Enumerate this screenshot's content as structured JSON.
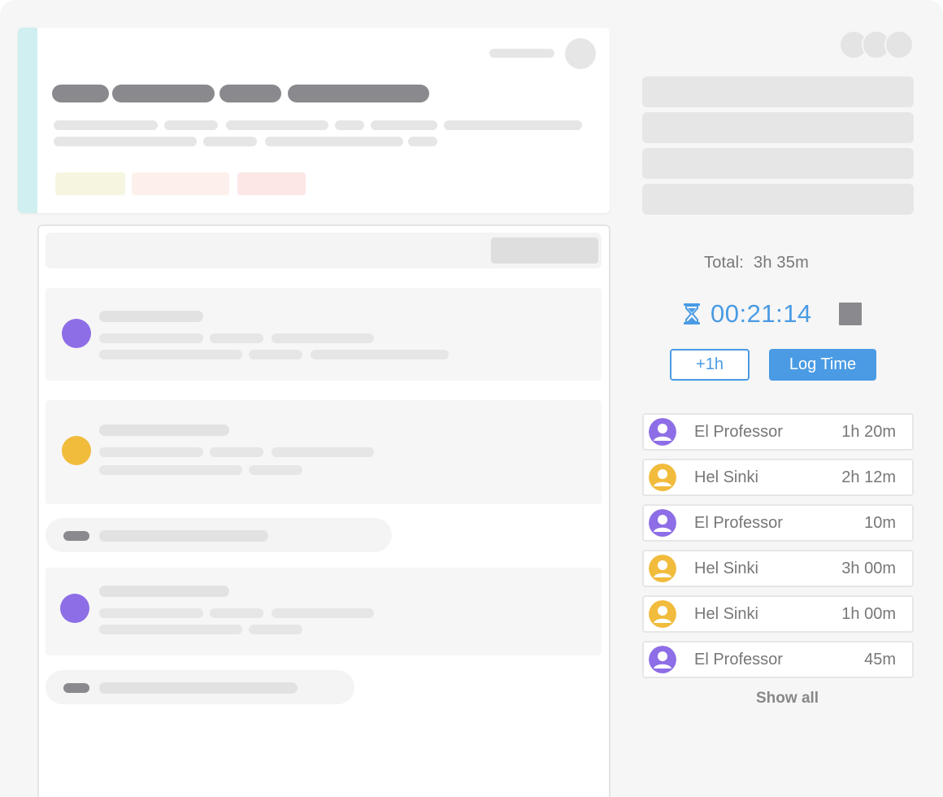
{
  "time_tracker": {
    "total_label": "Total:",
    "total_value": "3h 35m",
    "timer_value": "00:21:14",
    "timer_icon": "hourglass-icon",
    "stop_icon": "stop-icon",
    "add_hour_label": "+1h",
    "log_time_label": "Log Time",
    "show_all_label": "Show all"
  },
  "entries": [
    {
      "name": "El Professor",
      "duration": "1h 20m",
      "avatar_icon": "user-avatar-icon",
      "avatar_color": "#8e6ee6"
    },
    {
      "name": "Hel Sinki",
      "duration": "2h 12m",
      "avatar_icon": "user-avatar-icon",
      "avatar_color": "#f1bb3c"
    },
    {
      "name": "El Professor",
      "duration": "10m",
      "avatar_icon": "user-avatar-icon",
      "avatar_color": "#8e6ee6"
    },
    {
      "name": "Hel Sinki",
      "duration": "3h 00m",
      "avatar_icon": "user-avatar-icon",
      "avatar_color": "#f1bb3c"
    },
    {
      "name": "Hel Sinki",
      "duration": "1h 00m",
      "avatar_icon": "user-avatar-icon",
      "avatar_color": "#f1bb3c"
    },
    {
      "name": "El Professor",
      "duration": "45m",
      "avatar_icon": "user-avatar-icon",
      "avatar_color": "#8e6ee6"
    }
  ],
  "colors": {
    "accent_blue": "#4a9be4",
    "card_accent": "#cfeff0",
    "purple": "#8e6ee6",
    "yellow": "#f1bb3c",
    "tag_yellow": "#f6f6e0",
    "tag_peach": "#fdf0ec",
    "tag_pink": "#fce6e6"
  }
}
